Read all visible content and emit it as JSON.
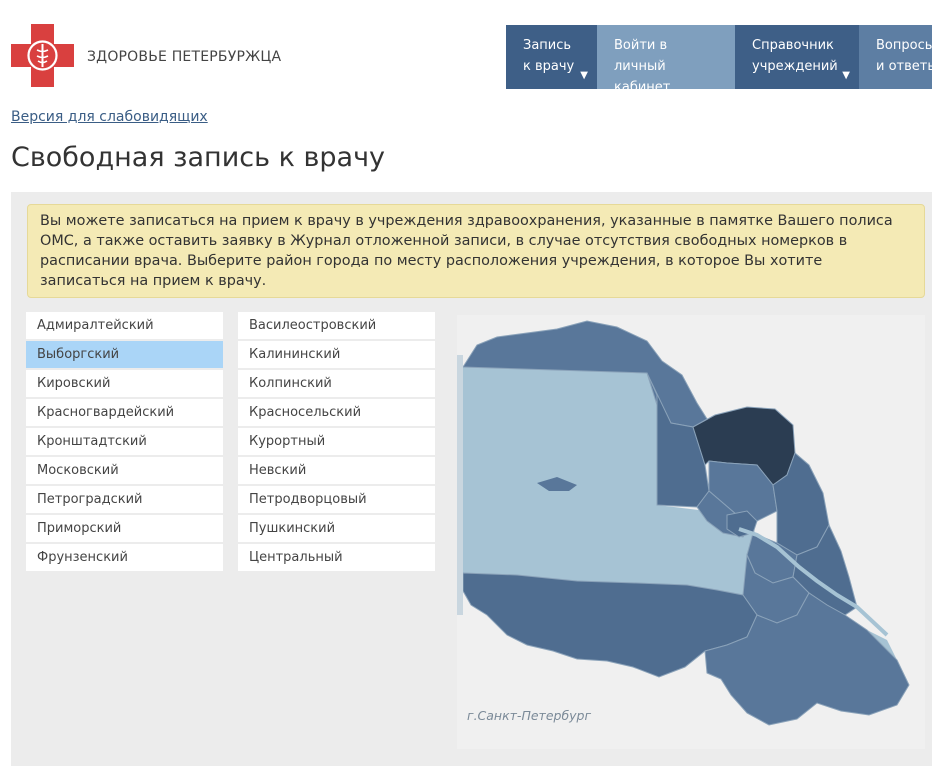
{
  "header": {
    "site_name": "ЗДОРОВЬЕ ПЕТЕРБУРЖЦА",
    "logo_icon": "red-cross-caduceus-icon",
    "nav": [
      {
        "line1": "Запись",
        "line2": "к врачу",
        "has_caret": true
      },
      {
        "line1": "Войти в",
        "line2": "личный кабинет",
        "has_caret": false
      },
      {
        "line1": "Справочник",
        "line2": "учреждений",
        "has_caret": true
      },
      {
        "line1": "Вопросы",
        "line2": "и ответы",
        "has_caret": false
      }
    ],
    "caret": "▼"
  },
  "accessibility_link": "Версия для слабовидящих",
  "page_title": "Свободная запись к врачу",
  "notice": "Вы можете записаться на прием к врачу в учреждения здравоохранения, указанные в памятке Вашего полиса ОМС, а также оставить заявку в Журнал отложенной записи, в случае отсутствия свободных номерков в расписании врача. Выберите район города по месту расположения учреждения, в которое Вы хотите записаться на прием к врачу.",
  "districts": {
    "column1": [
      "Адмиралтейский",
      "Выборгский",
      "Кировский",
      "Красногвардейский",
      "Кронштадтский",
      "Московский",
      "Петроградский",
      "Приморский",
      "Фрунзенский"
    ],
    "column2": [
      "Василеостровский",
      "Калининский",
      "Колпинский",
      "Красносельский",
      "Курортный",
      "Невский",
      "Петродворцовый",
      "Пушкинский",
      "Центральный"
    ],
    "selected": "Выборгский"
  },
  "map": {
    "caption": "г.Санкт-Петербург",
    "colors": {
      "water": "#a6c3d4",
      "district": "#59779a",
      "district_alt": "#4f6d90",
      "selected": "#2b3d52",
      "border": "#8aa2b9",
      "background": "#f0f0f0"
    }
  },
  "colors": {
    "nav_dark": "#3e5f87",
    "nav_light": "#7f9fbe",
    "notice_bg": "#f4eab5",
    "selected_item": "#aad5f7",
    "logo_red": "#d9403f"
  }
}
